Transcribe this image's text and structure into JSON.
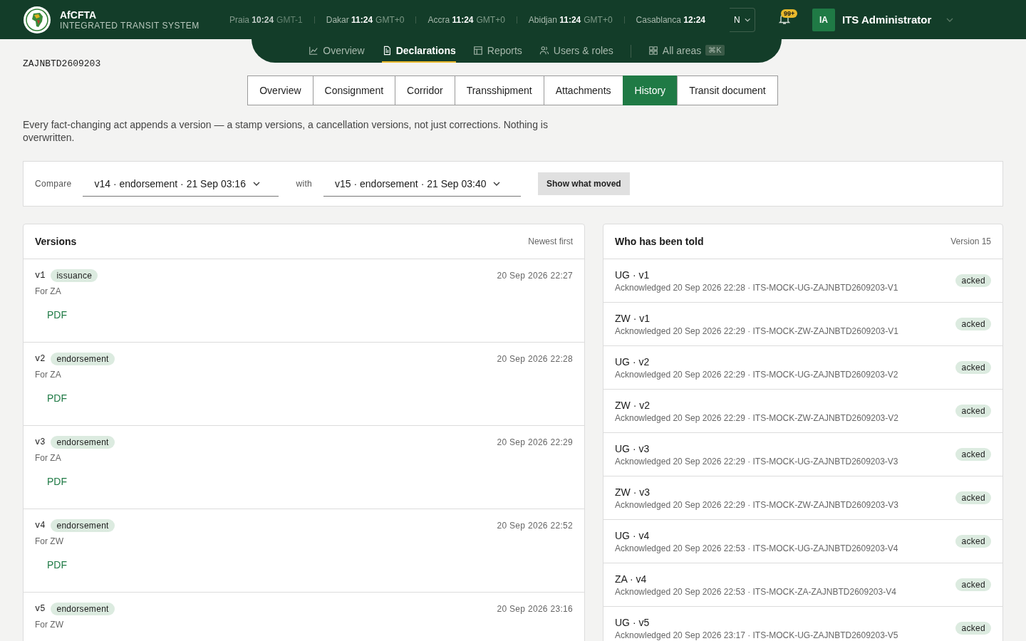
{
  "header": {
    "brand": "AfCFTA",
    "subtitle": "INTEGRATED TRANSIT SYSTEM",
    "clocks": [
      {
        "city": "Praia",
        "time": "10:24",
        "zone": "GMT-1"
      },
      {
        "city": "Dakar",
        "time": "11:24",
        "zone": "GMT+0"
      },
      {
        "city": "Accra",
        "time": "11:24",
        "zone": "GMT+0"
      },
      {
        "city": "Abidjan",
        "time": "11:24",
        "zone": "GMT+0"
      },
      {
        "city": "Casablanca",
        "time": "12:24"
      }
    ],
    "language_select": "N",
    "notification_badge": "99+",
    "user": {
      "initials": "IA",
      "name": "ITS Administrator"
    }
  },
  "nav": [
    {
      "label": "Overview",
      "selected": false
    },
    {
      "label": "Declarations",
      "selected": true
    },
    {
      "label": "Reports",
      "selected": false
    },
    {
      "label": "Users & roles",
      "selected": false
    },
    {
      "label": "All areas",
      "selected": false,
      "shortcut": "⌘K"
    }
  ],
  "declaration_id": "ZAJNBTD2609203",
  "tabs": [
    {
      "label": "Overview",
      "selected": false
    },
    {
      "label": "Consignment",
      "selected": false
    },
    {
      "label": "Corridor",
      "selected": false
    },
    {
      "label": "Transshipment",
      "selected": false
    },
    {
      "label": "Attachments",
      "selected": false
    },
    {
      "label": "History",
      "selected": true
    },
    {
      "label": "Transit document",
      "selected": false
    }
  ],
  "description": "Every fact-changing act appends a version — a stamp versions, a cancellation versions, not just corrections. Nothing is overwritten.",
  "compare": {
    "label": "Compare",
    "from": "v14 · endorsement · 21 Sep 03:16",
    "with_label": "with",
    "to": "v15 · endorsement · 21 Sep 03:40",
    "button": "Show what moved"
  },
  "versions": {
    "title": "Versions",
    "note": "Newest first",
    "rows": [
      {
        "version": "v1",
        "tag": "issuance",
        "date": "20 Sep 2026 22:27",
        "for": "For ZA",
        "link": "PDF"
      },
      {
        "version": "v2",
        "tag": "endorsement",
        "date": "20 Sep 2026 22:28",
        "for": "For ZA",
        "link": "PDF"
      },
      {
        "version": "v3",
        "tag": "endorsement",
        "date": "20 Sep 2026 22:29",
        "for": "For ZA",
        "link": "PDF"
      },
      {
        "version": "v4",
        "tag": "endorsement",
        "date": "20 Sep 2026 22:52",
        "for": "For ZW",
        "link": "PDF"
      },
      {
        "version": "v5",
        "tag": "endorsement",
        "date": "20 Sep 2026 23:16",
        "for": "For ZW"
      }
    ]
  },
  "told": {
    "title": "Who has been told",
    "note": "Version 15",
    "rows": [
      {
        "title": "UG · v1",
        "detail": "Acknowledged 20 Sep 2026 22:28 · ITS-MOCK-UG-ZAJNBTD2609203-V1",
        "status": "acked"
      },
      {
        "title": "ZW · v1",
        "detail": "Acknowledged 20 Sep 2026 22:29 · ITS-MOCK-ZW-ZAJNBTD2609203-V1",
        "status": "acked"
      },
      {
        "title": "UG · v2",
        "detail": "Acknowledged 20 Sep 2026 22:29 · ITS-MOCK-UG-ZAJNBTD2609203-V2",
        "status": "acked"
      },
      {
        "title": "ZW · v2",
        "detail": "Acknowledged 20 Sep 2026 22:29 · ITS-MOCK-ZW-ZAJNBTD2609203-V2",
        "status": "acked"
      },
      {
        "title": "UG · v3",
        "detail": "Acknowledged 20 Sep 2026 22:29 · ITS-MOCK-UG-ZAJNBTD2609203-V3",
        "status": "acked"
      },
      {
        "title": "ZW · v3",
        "detail": "Acknowledged 20 Sep 2026 22:29 · ITS-MOCK-ZW-ZAJNBTD2609203-V3",
        "status": "acked"
      },
      {
        "title": "UG · v4",
        "detail": "Acknowledged 20 Sep 2026 22:53 · ITS-MOCK-UG-ZAJNBTD2609203-V4",
        "status": "acked"
      },
      {
        "title": "ZA · v4",
        "detail": "Acknowledged 20 Sep 2026 22:53 · ITS-MOCK-ZA-ZAJNBTD2609203-V4",
        "status": "acked"
      },
      {
        "title": "UG · v5",
        "detail": "Acknowledged 20 Sep 2026 23:17 · ITS-MOCK-UG-ZAJNBTD2609203-V5",
        "status": "acked"
      }
    ]
  }
}
